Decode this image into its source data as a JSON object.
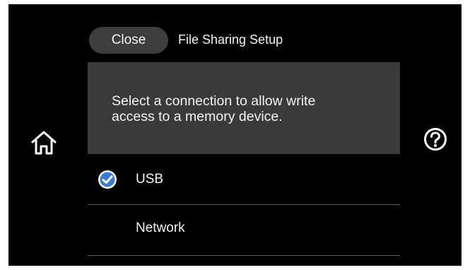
{
  "header": {
    "close_label": "Close",
    "title": "File Sharing Setup"
  },
  "message": {
    "line1": "Select a connection to allow write",
    "line2": "access to a memory device."
  },
  "options": [
    {
      "label": "USB",
      "selected": true
    },
    {
      "label": "Network",
      "selected": false
    }
  ],
  "icons": {
    "home": "home-icon",
    "help": "question-mark-icon",
    "selected": "check-circle-icon"
  },
  "colors": {
    "background": "#000000",
    "button_bg": "#3d3d3d",
    "panel_bg": "#3a3a3a",
    "text": "#f2f2f2",
    "accent": "#3a7bd5",
    "divider": "#5a5a5a"
  }
}
